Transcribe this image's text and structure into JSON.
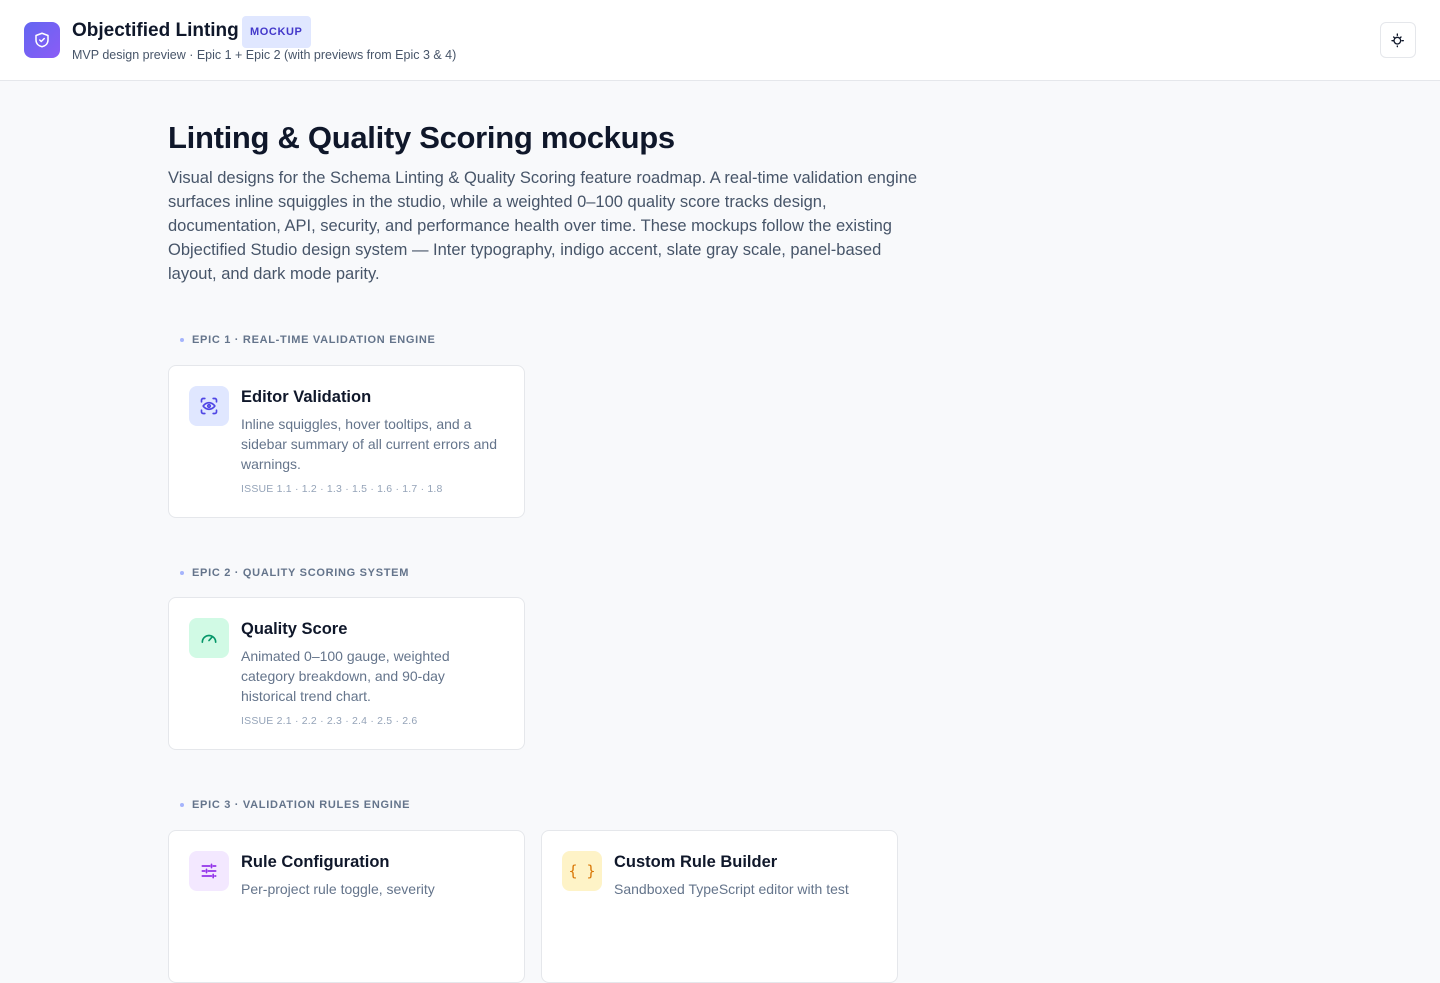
{
  "header": {
    "app_title": "Objectified Linting",
    "badge": "MOCKUP",
    "subtitle": "MVP design preview · Epic 1 + Epic 2 (with previews from Epic 3 & 4)"
  },
  "main": {
    "title": "Linting & Quality Scoring mockups",
    "intro": "Visual designs for the Schema Linting & Quality Scoring feature roadmap. A real-time validation engine surfaces inline squiggles in the studio, while a weighted 0–100 quality score tracks design, documentation, API, security, and performance health over time. These mockups follow the existing Objectified Studio design system — Inter typography, indigo accent, slate gray scale, panel-based layout, and dark mode parity."
  },
  "sections": [
    {
      "label": "EPIC 1 · REAL-TIME VALIDATION ENGINE",
      "cards": [
        {
          "title": "Editor Validation",
          "desc": "Inline squiggles, hover tooltips, and a sidebar summary of all current errors and warnings.",
          "issues": "ISSUE 1.1 · 1.2 · 1.3 · 1.5 · 1.6 · 1.7 · 1.8",
          "icon": "eye-scan-icon",
          "icon_color": "#4f46e5",
          "icon_bg": "#e0e7ff"
        }
      ]
    },
    {
      "label": "EPIC 2 · QUALITY SCORING SYSTEM",
      "cards": [
        {
          "title": "Quality Score",
          "desc": "Animated 0–100 gauge, weighted category breakdown, and 90-day historical trend chart.",
          "issues": "ISSUE 2.1 · 2.2 · 2.3 · 2.4 · 2.5 · 2.6",
          "icon": "gauge-icon",
          "icon_color": "#059669",
          "icon_bg": "#d1fae5"
        }
      ]
    },
    {
      "label": "EPIC 3 · VALIDATION RULES ENGINE",
      "cards": [
        {
          "title": "Rule Configuration",
          "desc": "Per-project rule toggle, severity",
          "icon": "sliders-icon",
          "icon_color": "#9333ea",
          "icon_bg": "#f3e8ff"
        },
        {
          "title": "Custom Rule Builder",
          "desc": "Sandboxed TypeScript editor with test",
          "icon": "braces-icon",
          "icon_color": "#d97706",
          "icon_bg": "#fef3c7",
          "glyph": "{ }"
        }
      ]
    }
  ]
}
